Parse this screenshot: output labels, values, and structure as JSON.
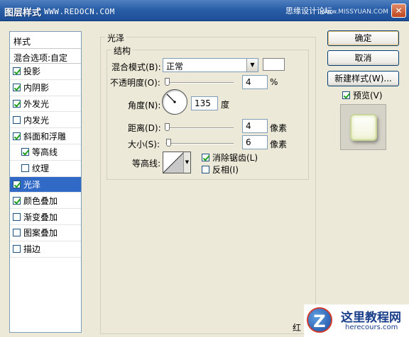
{
  "window": {
    "title": "图层样式",
    "watermark": "WWW.REDOCN.COM",
    "forum": "思缘设计论坛",
    "forum_url": "www.MISSYUAN.COM",
    "close_glyph": "✕"
  },
  "sidebar": {
    "header": "样式",
    "blend_options": "混合选项:自定",
    "items": [
      {
        "label": "投影",
        "checked": true
      },
      {
        "label": "内阴影",
        "checked": true
      },
      {
        "label": "外发光",
        "checked": true
      },
      {
        "label": "内发光",
        "checked": false
      },
      {
        "label": "斜面和浮雕",
        "checked": true
      },
      {
        "label": "等高线",
        "checked": true
      },
      {
        "label": "纹理",
        "checked": false
      },
      {
        "label": "光泽",
        "checked": true
      },
      {
        "label": "颜色叠加",
        "checked": true
      },
      {
        "label": "渐变叠加",
        "checked": false
      },
      {
        "label": "图案叠加",
        "checked": false
      },
      {
        "label": "描边",
        "checked": false
      }
    ]
  },
  "panel": {
    "section_title": "光泽",
    "structure_title": "结构",
    "blend_mode_label": "混合模式(B):",
    "blend_mode_value": "正常",
    "opacity_label": "不透明度(O):",
    "opacity_value": "4",
    "opacity_unit": "%",
    "angle_label": "角度(N):",
    "angle_value": "135",
    "angle_unit": "度",
    "distance_label": "距离(D):",
    "distance_value": "4",
    "distance_unit": "像素",
    "size_label": "大小(S):",
    "size_value": "6",
    "size_unit": "像素",
    "contour_label": "等高线:",
    "antialias_label": "消除锯齿(L)",
    "antialias_checked": true,
    "invert_label": "反相(I)",
    "invert_checked": false,
    "swatch_color": "#ffffff"
  },
  "buttons": {
    "ok": "确定",
    "cancel": "取消",
    "new_style": "新建样式(W)...",
    "preview_label": "预览(V)",
    "preview_checked": true
  },
  "logo": {
    "badge": "Z",
    "name": "这里教程网",
    "url": "herecours.com",
    "partial_text": "红"
  },
  "colors": {
    "selection": "#3169c6",
    "titlebar": "#2a5fa8",
    "dialog_bg": "#ece9d8"
  }
}
